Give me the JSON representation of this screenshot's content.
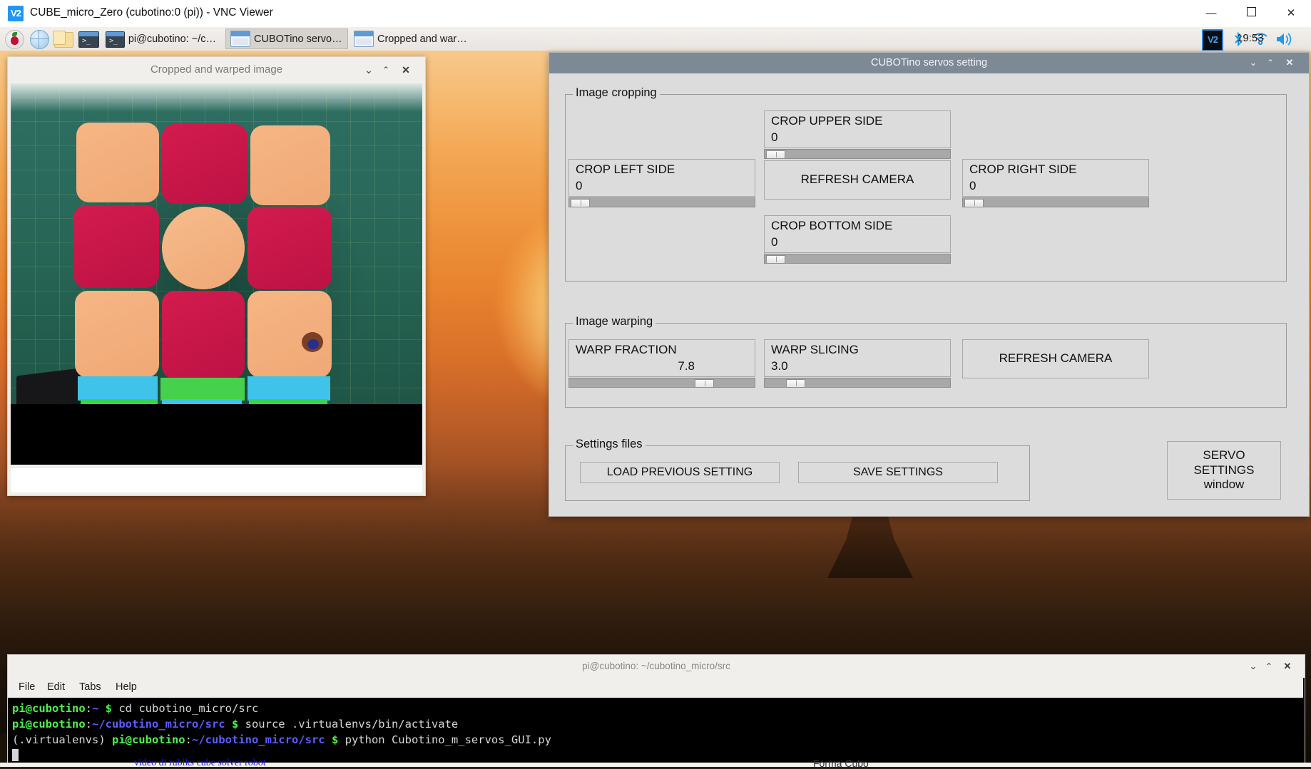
{
  "vnc": {
    "title": "CUBE_micro_Zero (cubotino:0 (pi)) - VNC Viewer",
    "logo": "V2",
    "minimize": "—",
    "maximize": "☐",
    "close": "✕"
  },
  "taskbar": {
    "icons": [
      "raspberry-menu",
      "web-browser",
      "file-manager",
      "terminal"
    ],
    "tasks": [
      {
        "label": "pi@cubotino: ~/cub…",
        "icon": "terminal-icon",
        "active": false
      },
      {
        "label": "CUBOTino servos se…",
        "icon": "window-icon",
        "active": true
      },
      {
        "label": "Cropped and warped…",
        "icon": "window-icon",
        "active": false
      }
    ],
    "tray": {
      "vnc_badge": "V2",
      "bluetooth": "ᛦ",
      "wifi": "wifi-icon",
      "volume": "volume-icon",
      "clock": "19:53"
    }
  },
  "image_window": {
    "title": "Cropped and warped image",
    "minimize": "⌄",
    "maximize": "⌃",
    "close": "✕",
    "content": "rubiks-cube-photo"
  },
  "dialog": {
    "title": "CUBOTino servos setting",
    "minimize": "⌄",
    "maximize": "⌃",
    "close": "✕",
    "groups": {
      "cropping": {
        "label": "Image cropping",
        "controls": [
          {
            "name": "CROP UPPER SIDE",
            "value": "0",
            "pos": 2,
            "align": "left"
          },
          {
            "name": "CROP LEFT SIDE",
            "value": "0",
            "pos": 2,
            "align": "left"
          },
          {
            "name": "CROP RIGHT SIDE",
            "value": "0",
            "pos": 2,
            "align": "left"
          },
          {
            "name": "CROP BOTTOM SIDE",
            "value": "0",
            "pos": 2,
            "align": "left"
          }
        ],
        "refresh_button": "REFRESH CAMERA"
      },
      "warping": {
        "label": "Image warping",
        "controls": [
          {
            "name": "WARP FRACTION",
            "value": "7.8",
            "pos": 68,
            "align": "right"
          },
          {
            "name": "WARP SLICING",
            "value": "3.0",
            "pos": 13,
            "align": "left"
          }
        ],
        "refresh_button": "REFRESH CAMERA"
      },
      "files": {
        "label": "Settings files",
        "load_button": "LOAD PREVIOUS SETTING",
        "save_button": "SAVE SETTINGS"
      }
    },
    "servo_button": {
      "line1": "SERVO",
      "line2": "SETTINGS",
      "line3": "window"
    }
  },
  "terminal": {
    "title": "pi@cubotino: ~/cubotino_micro/src",
    "minimize": "⌄",
    "maximize": "⌃",
    "close": "✕",
    "menu": [
      "File",
      "Edit",
      "Tabs",
      "Help"
    ],
    "lines": [
      {
        "prompt_user": "pi@cubotino",
        "sep": ":",
        "path": "~",
        "dollar": " $ ",
        "cmd": "cd cubotino_micro/src",
        "venv": ""
      },
      {
        "prompt_user": "pi@cubotino",
        "sep": ":",
        "path": "~/cubotino_micro/src",
        "dollar": " $ ",
        "cmd": "source .virtualenvs/bin/activate",
        "venv": ""
      },
      {
        "prompt_user": "pi@cubotino",
        "sep": ":",
        "path": "~/cubotino_micro/src",
        "dollar": " $ ",
        "cmd": "python Cubotino_m_servos_GUI.py",
        "venv": "(.virtualenvs) "
      }
    ]
  },
  "background_page": {
    "link_text": "video di rubiks cube solver robot",
    "right_text": "Forma  Cubo"
  },
  "colors": {
    "dialog_bg": "#dcdcdc",
    "dialog_titlebar": "#7d8a96",
    "trough": "#a8a8a8",
    "terminal_green": "#4ef04e",
    "terminal_blue": "#5c5cff",
    "accent_blue": "#2196f3"
  }
}
